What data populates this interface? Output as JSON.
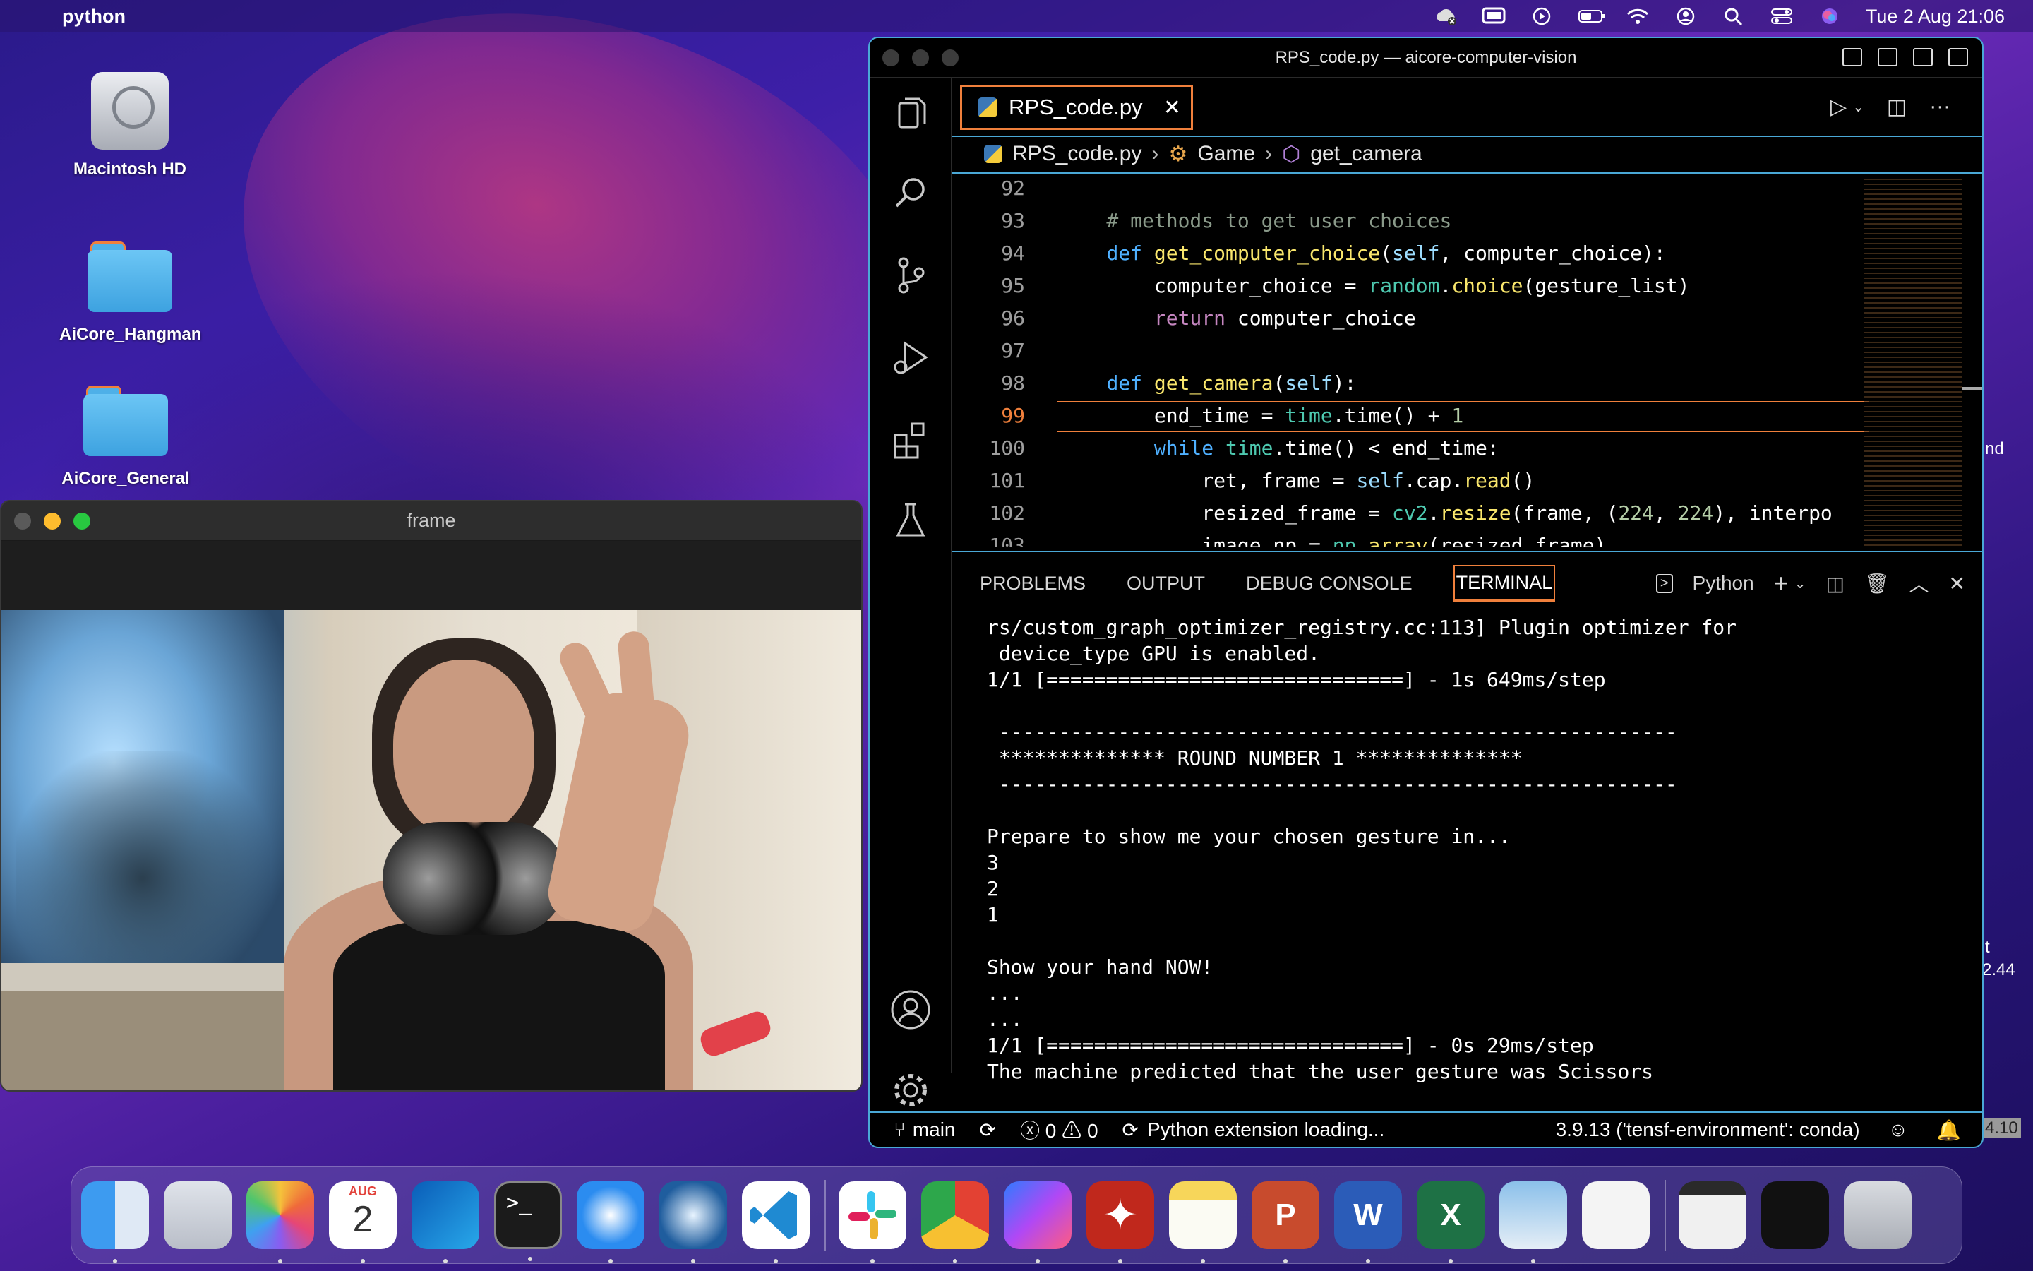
{
  "menubar": {
    "app_name": "python",
    "datetime": "Tue 2 Aug  21:06",
    "icons": [
      "cloud-off-icon",
      "display-icon",
      "play-circle-icon",
      "battery-icon",
      "wifi-icon",
      "user-icon",
      "search-icon",
      "control-center-icon",
      "siri-icon"
    ]
  },
  "desktop": {
    "icons": [
      {
        "label": "Macintosh HD",
        "type": "drive"
      },
      {
        "label": "AiCore_Hangman",
        "type": "folder"
      },
      {
        "label": "AiCore_General",
        "type": "folder"
      }
    ],
    "edge_texts": [
      "nd",
      "t",
      "2.44",
      "4.10"
    ]
  },
  "camera_window": {
    "title": "frame"
  },
  "vscode": {
    "title": "RPS_code.py — aicore-computer-vision",
    "tab": {
      "label": "RPS_code.py",
      "close": "✕"
    },
    "breadcrumb": {
      "file": "RPS_code.py",
      "class": "Game",
      "method": "get_camera"
    },
    "activity_icons": [
      "explorer-icon",
      "search-icon",
      "source-control-icon",
      "run-debug-icon",
      "extensions-icon",
      "testing-icon",
      "account-icon",
      "settings-gear-icon"
    ],
    "code_lines": [
      {
        "n": "92",
        "text": ""
      },
      {
        "n": "93",
        "text": "    # methods to get user choices"
      },
      {
        "n": "94",
        "text": "    def get_computer_choice(self, computer_choice):"
      },
      {
        "n": "95",
        "text": "        computer_choice = random.choice(gesture_list)"
      },
      {
        "n": "96",
        "text": "        return computer_choice"
      },
      {
        "n": "97",
        "text": ""
      },
      {
        "n": "98",
        "text": "    def get_camera(self):"
      },
      {
        "n": "99",
        "text": "        end_time = time.time() + 1"
      },
      {
        "n": "100",
        "text": "        while time.time() < end_time:"
      },
      {
        "n": "101",
        "text": "            ret, frame = self.cap.read()"
      },
      {
        "n": "102",
        "text": "            resized_frame = cv2.resize(frame, (224, 224), interpo"
      },
      {
        "n": "103",
        "text": "            image_np = np.array(resized_frame)"
      }
    ],
    "current_line": "99",
    "panel": {
      "tabs": [
        "PROBLEMS",
        "OUTPUT",
        "DEBUG CONSOLE",
        "TERMINAL"
      ],
      "active_tab": "TERMINAL",
      "shell": "Python",
      "terminal_lines": [
        "rs/custom_graph_optimizer_registry.cc:113] Plugin optimizer for",
        " device_type GPU is enabled.",
        "1/1 [==============================] - 1s 649ms/step",
        "",
        " ---------------------------------------------------------",
        " ************** ROUND NUMBER 1 **************",
        " ---------------------------------------------------------",
        "",
        "Prepare to show me your chosen gesture in...",
        "3",
        "2",
        "1",
        "",
        "Show your hand NOW!",
        "...",
        "...",
        "1/1 [==============================] - 0s 29ms/step",
        "The machine predicted that the user gesture was Scissors"
      ]
    },
    "statusbar": {
      "branch": "main",
      "errors": "0",
      "warnings": "0",
      "loading": "Python extension loading...",
      "interpreter": "3.9.13 ('tensf-environment': conda)"
    }
  },
  "dock": {
    "apps": [
      "Finder",
      "Launchpad",
      "Photos",
      "Calendar",
      "Outlook",
      "Terminal",
      "Safari",
      "QuickTime Player",
      "Visual Studio Code",
      "Slack",
      "Google Chrome",
      "Messenger",
      "Adobe Acrobat",
      "Notes",
      "PowerPoint",
      "Word",
      "Excel",
      "Preview",
      "Document",
      "Window Thumbnail 1",
      "Window Thumbnail 2",
      "Trash"
    ],
    "calendar_month": "AUG",
    "calendar_day": "2",
    "colors": {
      "finder": "#3d9bf0",
      "vscode": "#1f8ad2",
      "chrome": "#e34133",
      "slack": "#ffffff",
      "acrobat": "#c0281c",
      "excel": "#1e7145",
      "word": "#2b5cb8",
      "powerpoint": "#c84b2d"
    }
  }
}
